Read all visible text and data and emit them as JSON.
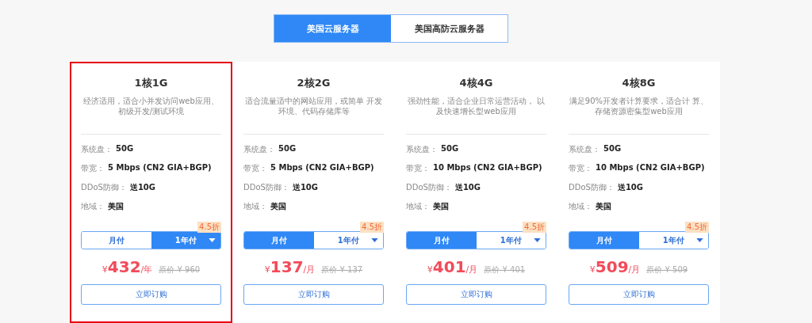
{
  "tabs": [
    {
      "label": "美国云服务器",
      "selected": true
    },
    {
      "label": "美国高防云服务器",
      "selected": false
    }
  ],
  "plans": [
    {
      "title": "1核1G",
      "highlighted": true,
      "description": "经济适用，适合小并发访问web应用、初级开发/测试环境",
      "specs": [
        {
          "label": "系统盘：",
          "value": "50G"
        },
        {
          "label": "带宽：",
          "value": "5 Mbps (CN2 GIA+BGP)"
        },
        {
          "label": "DDoS防御：",
          "value": "送10G"
        },
        {
          "label": "地域：",
          "value": "美国"
        }
      ],
      "billing": [
        {
          "label": "月付",
          "selected": false
        },
        {
          "label": "1年付",
          "selected": true
        }
      ],
      "discount": "4.5折",
      "currency": "¥",
      "price": "432",
      "period": "/年",
      "original_price": "原价 ¥ 960",
      "order_button": "立即订购"
    },
    {
      "title": "2核2G",
      "highlighted": false,
      "description": "适合流量适中的网站应用，或简单 开发环境、代码存储库等",
      "specs": [
        {
          "label": "系统盘：",
          "value": "50G"
        },
        {
          "label": "带宽：",
          "value": "5 Mbps (CN2 GIA+BGP)"
        },
        {
          "label": "DDoS防御：",
          "value": "送10G"
        },
        {
          "label": "地域：",
          "value": "美国"
        }
      ],
      "billing": [
        {
          "label": "月付",
          "selected": true
        },
        {
          "label": "1年付",
          "selected": false
        }
      ],
      "discount": "4.5折",
      "currency": "¥",
      "price": "137",
      "period": "/月",
      "original_price": "原价 ¥ 137",
      "order_button": "立即订购"
    },
    {
      "title": "4核4G",
      "highlighted": false,
      "description": "强劲性能，适合企业日常运营活动， 以及快速增长型web应用",
      "specs": [
        {
          "label": "系统盘：",
          "value": "50G"
        },
        {
          "label": "带宽：",
          "value": "10 Mbps (CN2 GIA+BGP)"
        },
        {
          "label": "DDoS防御：",
          "value": "送10G"
        },
        {
          "label": "地域：",
          "value": "美国"
        }
      ],
      "billing": [
        {
          "label": "月付",
          "selected": true
        },
        {
          "label": "1年付",
          "selected": false
        }
      ],
      "discount": "4.5折",
      "currency": "¥",
      "price": "401",
      "period": "/月",
      "original_price": "原价 ¥ 401",
      "order_button": "立即订购"
    },
    {
      "title": "4核8G",
      "highlighted": false,
      "description": "满足90%开发者计算要求，适合计 算、存储资源密集型web应用",
      "specs": [
        {
          "label": "系统盘：",
          "value": "50G"
        },
        {
          "label": "带宽：",
          "value": "10 Mbps (CN2 GIA+BGP)"
        },
        {
          "label": "DDoS防御：",
          "value": "送10G"
        },
        {
          "label": "地域：",
          "value": "美国"
        }
      ],
      "billing": [
        {
          "label": "月付",
          "selected": true
        },
        {
          "label": "1年付",
          "selected": false
        }
      ],
      "discount": "4.5折",
      "currency": "¥",
      "price": "509",
      "period": "/月",
      "original_price": "原价 ¥ 509",
      "order_button": "立即订购"
    }
  ]
}
